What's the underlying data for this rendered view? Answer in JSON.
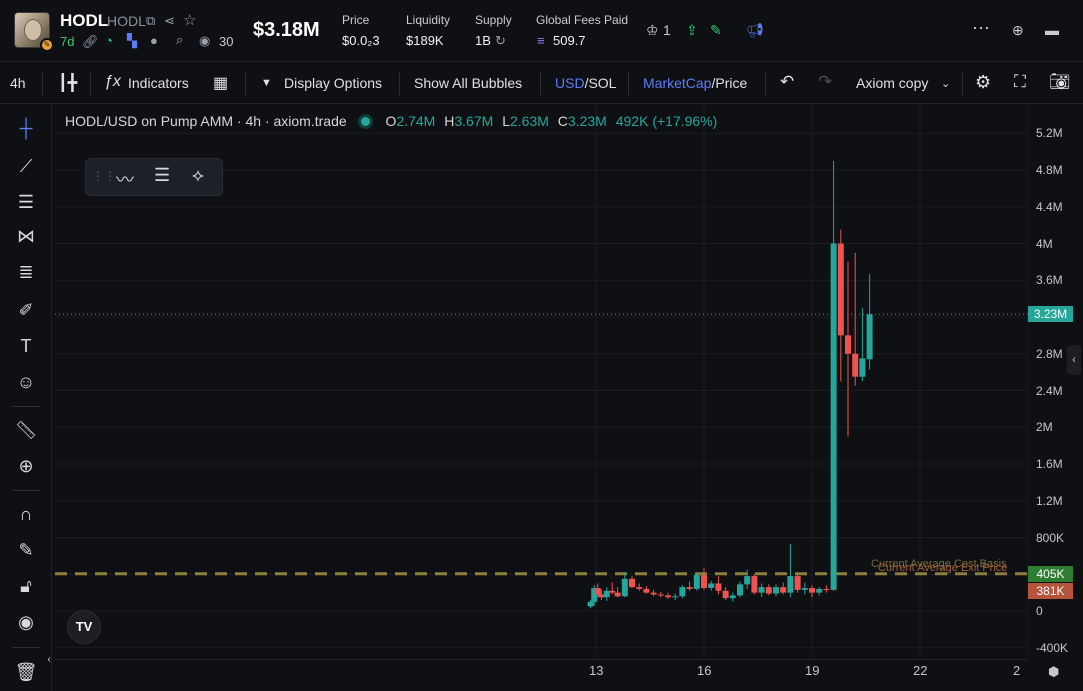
{
  "header": {
    "token_name": "HODL",
    "token_symbol": "HODL",
    "age": "7d",
    "views": "30",
    "market_cap": "$3.18M",
    "price_label": "Price",
    "price_value": "$0.0₂3",
    "liquidity_label": "Liquidity",
    "liquidity_value": "$189K",
    "supply_label": "Supply",
    "supply_value": "1B",
    "fees_label": "Global Fees Paid",
    "fees_value": "509.7",
    "crown_count": "1"
  },
  "toolbar": {
    "interval": "4h",
    "indicators": "Indicators",
    "display_options": "Display Options",
    "show_all_bubbles": "Show All Bubbles",
    "usd": "USD",
    "sol": "SOL",
    "marketcap": "MarketCap",
    "price": "Price",
    "layout_name": "Axiom copy"
  },
  "legend": {
    "title": "HODL/USD on Pump AMM · 4h · axiom.trade",
    "o_label": "O",
    "o": "2.74M",
    "h_label": "H",
    "h": "3.67M",
    "l_label": "L",
    "l": "2.63M",
    "c_label": "C",
    "c": "3.23M",
    "change": "492K (+17.96%)"
  },
  "overlays": {
    "cost_basis_label": "Current Average Cost Basis",
    "exit_price_label": "Current Average Exit Price"
  },
  "colors": {
    "up": "#26a69a",
    "down": "#ef5350",
    "accent_blue": "#5b7cf4",
    "cost_line": "#8b7f3a"
  },
  "chart_data": {
    "type": "candlestick",
    "title": "HODL/USD on Pump AMM · 4h · axiom.trade",
    "y_ticks": [
      "5.2M",
      "4.8M",
      "4.4M",
      "4M",
      "3.6M",
      "3.2M",
      "2.8M",
      "2.4M",
      "2M",
      "1.6M",
      "1.2M",
      "800K",
      "400K",
      "0",
      "-400K"
    ],
    "ylim": [
      -480000,
      5400000
    ],
    "x_ticks": [
      "13",
      "16",
      "19",
      "22",
      "2"
    ],
    "current_price": "3.23M",
    "cost_basis_value": "405K",
    "exit_price_value": "381K",
    "candles": [
      [
        12.85,
        50000,
        120000,
        30000,
        100000
      ],
      [
        12.95,
        100000,
        280000,
        60000,
        250000
      ],
      [
        13.05,
        250000,
        300000,
        150000,
        180000
      ],
      [
        13.15,
        180000,
        230000,
        120000,
        150000
      ],
      [
        13.3,
        150000,
        260000,
        110000,
        220000
      ],
      [
        13.45,
        220000,
        310000,
        180000,
        200000
      ],
      [
        13.6,
        200000,
        260000,
        150000,
        160000
      ],
      [
        13.8,
        160000,
        420000,
        150000,
        350000
      ],
      [
        14.0,
        350000,
        380000,
        250000,
        260000
      ],
      [
        14.2,
        260000,
        300000,
        220000,
        240000
      ],
      [
        14.4,
        240000,
        270000,
        190000,
        200000
      ],
      [
        14.6,
        200000,
        230000,
        160000,
        180000
      ],
      [
        14.8,
        180000,
        210000,
        150000,
        170000
      ],
      [
        15.0,
        170000,
        200000,
        130000,
        150000
      ],
      [
        15.2,
        150000,
        190000,
        120000,
        160000
      ],
      [
        15.4,
        160000,
        280000,
        140000,
        260000
      ],
      [
        15.6,
        260000,
        320000,
        220000,
        240000
      ],
      [
        15.8,
        240000,
        420000,
        220000,
        390000
      ],
      [
        16.0,
        390000,
        470000,
        230000,
        250000
      ],
      [
        16.2,
        250000,
        330000,
        220000,
        300000
      ],
      [
        16.4,
        300000,
        380000,
        180000,
        220000
      ],
      [
        16.6,
        220000,
        260000,
        120000,
        140000
      ],
      [
        16.8,
        140000,
        200000,
        100000,
        170000
      ],
      [
        17.0,
        170000,
        320000,
        150000,
        290000
      ],
      [
        17.2,
        290000,
        450000,
        240000,
        380000
      ],
      [
        17.4,
        380000,
        400000,
        180000,
        200000
      ],
      [
        17.6,
        200000,
        300000,
        150000,
        260000
      ],
      [
        17.8,
        260000,
        290000,
        170000,
        190000
      ],
      [
        18.0,
        190000,
        290000,
        160000,
        260000
      ],
      [
        18.2,
        260000,
        310000,
        180000,
        200000
      ],
      [
        18.4,
        200000,
        730000,
        150000,
        380000
      ],
      [
        18.6,
        380000,
        400000,
        200000,
        230000
      ],
      [
        18.8,
        230000,
        310000,
        180000,
        250000
      ],
      [
        19.0,
        250000,
        280000,
        150000,
        200000
      ],
      [
        19.2,
        200000,
        260000,
        170000,
        240000
      ],
      [
        19.4,
        240000,
        280000,
        200000,
        230000
      ],
      [
        19.6,
        230000,
        4900000,
        220000,
        4000000
      ],
      [
        19.8,
        4000000,
        4150000,
        2500000,
        3000000
      ],
      [
        20.0,
        3000000,
        3800000,
        1900000,
        2800000
      ],
      [
        20.2,
        2800000,
        3900000,
        2450000,
        2550000
      ],
      [
        20.4,
        2550000,
        3300000,
        2500000,
        2750000
      ],
      [
        20.6,
        2740000,
        3670000,
        2630000,
        3230000
      ]
    ]
  }
}
